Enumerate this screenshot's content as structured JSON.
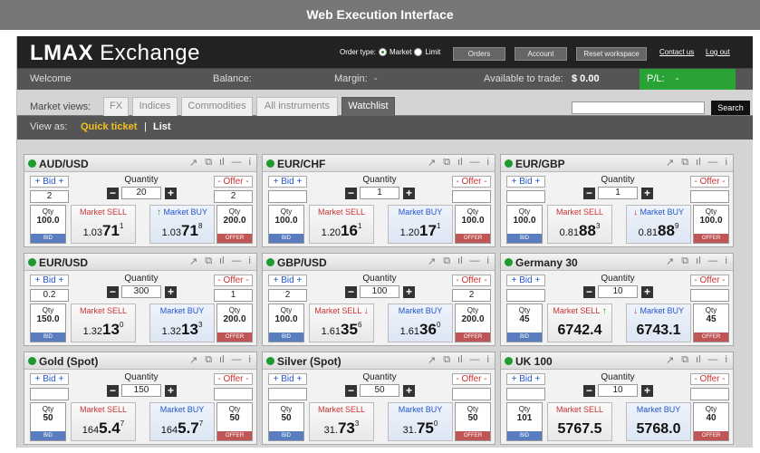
{
  "caption": "Web Execution Interface",
  "header": {
    "logo_bold": "LMAX",
    "logo_rest": " Exchange",
    "order_type_label": "Order type:",
    "order_market": "Market",
    "order_limit": "Limit",
    "selected_order_type": "Market",
    "orders_btn": "Orders",
    "account_btn": "Account",
    "reset_btn": "Reset workspace",
    "contact_link": "Contact us",
    "logout_link": "Log out"
  },
  "status": {
    "welcome": "Welcome",
    "balance": "Balance:",
    "margin": "Margin:",
    "margin_value": "-",
    "available": "Available to trade:",
    "available_value": "$ 0.00",
    "pl": "P/L:",
    "pl_value": "-"
  },
  "tabs": {
    "label": "Market views:",
    "items": [
      "FX",
      "Indices",
      "Commodities",
      "All instruments",
      "Watchlist"
    ],
    "active": "Watchlist",
    "search_button": "Search"
  },
  "view": {
    "label": "View as:",
    "quick": "Quick ticket",
    "sep": "|",
    "list": "List"
  },
  "labels": {
    "bid": "+ Bid +",
    "offer": "- Offer -",
    "quantity": "Quantity",
    "qty": "Qty",
    "bid_small": "BID",
    "offer_small": "OFFER",
    "sell": "Market SELL",
    "buy": "Market BUY"
  },
  "colors": {
    "accent_green": "#2aa336",
    "sell_red": "#cc3333",
    "buy_blue": "#2255cc"
  },
  "instruments": [
    {
      "name": "AUD/USD",
      "bid_input": "2",
      "quantity": "20",
      "offer_input": "2",
      "bid_qty": "100.0",
      "offer_qty": "200.0",
      "sell": {
        "pre": "1.03",
        "big": "71",
        "sup": "1",
        "full": "",
        "arrow": ""
      },
      "buy": {
        "pre": "1.03",
        "big": "71",
        "sup": "8",
        "full": "",
        "arrow": "up"
      }
    },
    {
      "name": "EUR/CHF",
      "bid_input": "",
      "quantity": "1",
      "offer_input": "",
      "bid_qty": "100.0",
      "offer_qty": "100.0",
      "sell": {
        "pre": "1.20",
        "big": "16",
        "sup": "1",
        "full": "",
        "arrow": ""
      },
      "buy": {
        "pre": "1.20",
        "big": "17",
        "sup": "1",
        "full": "",
        "arrow": ""
      }
    },
    {
      "name": "EUR/GBP",
      "bid_input": "",
      "quantity": "1",
      "offer_input": "",
      "bid_qty": "100.0",
      "offer_qty": "100.0",
      "sell": {
        "pre": "0.81",
        "big": "88",
        "sup": "3",
        "full": "",
        "arrow": ""
      },
      "buy": {
        "pre": "0.81",
        "big": "88",
        "sup": "9",
        "full": "",
        "arrow": "down"
      }
    },
    {
      "name": "EUR/USD",
      "bid_input": "0.2",
      "quantity": "300",
      "offer_input": "1",
      "bid_qty": "150.0",
      "offer_qty": "200.0",
      "sell": {
        "pre": "1.32",
        "big": "13",
        "sup": "0",
        "full": "",
        "arrow": ""
      },
      "buy": {
        "pre": "1.32",
        "big": "13",
        "sup": "3",
        "full": "",
        "arrow": ""
      }
    },
    {
      "name": "GBP/USD",
      "bid_input": "2",
      "quantity": "100",
      "offer_input": "2",
      "bid_qty": "100.0",
      "offer_qty": "200.0",
      "sell": {
        "pre": "1.61",
        "big": "35",
        "sup": "6",
        "full": "",
        "arrow": "down"
      },
      "buy": {
        "pre": "1.61",
        "big": "36",
        "sup": "0",
        "full": "",
        "arrow": ""
      }
    },
    {
      "name": "Germany 30",
      "bid_input": "",
      "quantity": "10",
      "offer_input": "",
      "bid_qty": "45",
      "offer_qty": "45",
      "sell": {
        "pre": "",
        "big": "",
        "sup": "",
        "full": "6742.4",
        "arrow": "up"
      },
      "buy": {
        "pre": "",
        "big": "",
        "sup": "",
        "full": "6743.1",
        "arrow": "down"
      }
    },
    {
      "name": "Gold (Spot)",
      "bid_input": "",
      "quantity": "150",
      "offer_input": "",
      "bid_qty": "50",
      "offer_qty": "50",
      "sell": {
        "pre": "164",
        "big": "5.4",
        "sup": "7",
        "full": "",
        "arrow": ""
      },
      "buy": {
        "pre": "164",
        "big": "5.7",
        "sup": "7",
        "full": "",
        "arrow": ""
      }
    },
    {
      "name": "Silver (Spot)",
      "bid_input": "",
      "quantity": "50",
      "offer_input": "",
      "bid_qty": "50",
      "offer_qty": "50",
      "sell": {
        "pre": "31.",
        "big": "73",
        "sup": "3",
        "full": "",
        "arrow": ""
      },
      "buy": {
        "pre": "31.",
        "big": "75",
        "sup": "0",
        "full": "",
        "arrow": ""
      }
    },
    {
      "name": "UK 100",
      "bid_input": "",
      "quantity": "10",
      "offer_input": "",
      "bid_qty": "101",
      "offer_qty": "40",
      "sell": {
        "pre": "",
        "big": "",
        "sup": "",
        "full": "5767.5",
        "arrow": ""
      },
      "buy": {
        "pre": "",
        "big": "",
        "sup": "",
        "full": "5768.0",
        "arrow": ""
      }
    }
  ]
}
